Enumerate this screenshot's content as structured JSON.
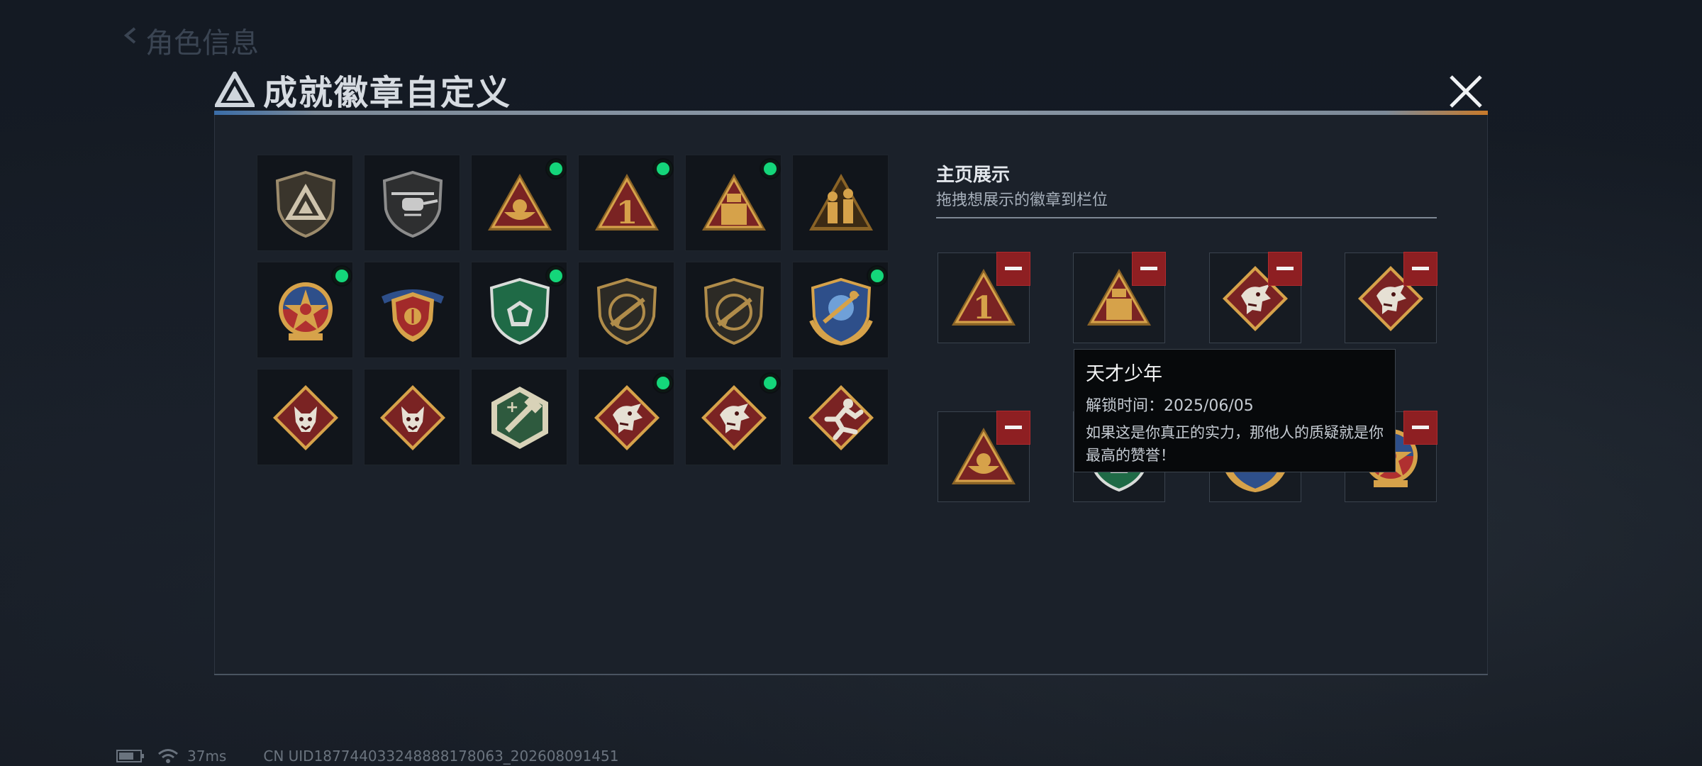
{
  "background": {
    "title": "角色信息"
  },
  "dialog": {
    "title": "成就徽章自定义",
    "close_icon": "close-icon"
  },
  "badges": [
    {
      "name": "triangle-shield-badge",
      "new": false
    },
    {
      "name": "helicopter-badge",
      "new": false
    },
    {
      "name": "triangle-bowl-badge",
      "new": true
    },
    {
      "name": "triangle-number-one-badge",
      "new": true
    },
    {
      "name": "triangle-tower-badge",
      "new": true
    },
    {
      "name": "triangle-soldiers-badge",
      "new": false
    },
    {
      "name": "star-medal-badge",
      "new": true
    },
    {
      "name": "winged-shield-badge",
      "new": false
    },
    {
      "name": "green-gem-shield-badge",
      "new": true
    },
    {
      "name": "rifle-shield-badge",
      "new": false
    },
    {
      "name": "rifle-shield-dark-badge",
      "new": false
    },
    {
      "name": "blue-laurel-shield-badge",
      "new": true
    },
    {
      "name": "wolf-diamond-badge",
      "new": false
    },
    {
      "name": "wolf-diamond-badge-2",
      "new": false
    },
    {
      "name": "green-hammer-badge",
      "new": false
    },
    {
      "name": "dragon-diamond-badge",
      "new": true
    },
    {
      "name": "dragon-diamond-badge-2",
      "new": true
    },
    {
      "name": "runner-diamond-badge",
      "new": false
    }
  ],
  "showcase": {
    "title": "主页展示",
    "subtitle": "拖拽想展示的徽章到栏位",
    "slots": [
      {
        "badge": "triangle-number-one-badge"
      },
      {
        "badge": "triangle-tower-badge"
      },
      {
        "badge": "dragon-diamond-badge"
      },
      {
        "badge": "dragon-diamond-badge-2"
      },
      {
        "badge": "triangle-bowl-badge"
      },
      {
        "badge": "green-gem-shield-badge"
      },
      {
        "badge": "blue-laurel-shield-badge"
      },
      {
        "badge": "star-medal-badge"
      }
    ]
  },
  "tooltip": {
    "title": "天才少年",
    "unlock_time": "解锁时间：2025/06/05",
    "description": "如果这是你真正的实力，那他人的质疑就是你最高的赞誉！"
  },
  "status_bar": {
    "ping": "37ms",
    "uid": "CN UID1877440332488881780​63_2026080​91451"
  },
  "colors": {
    "panel_bg": "#1b212a",
    "new_dot": "#14d67a",
    "remove": "#8e1f22",
    "gold": "#d6a24a",
    "red_bg": "#7a2323"
  }
}
